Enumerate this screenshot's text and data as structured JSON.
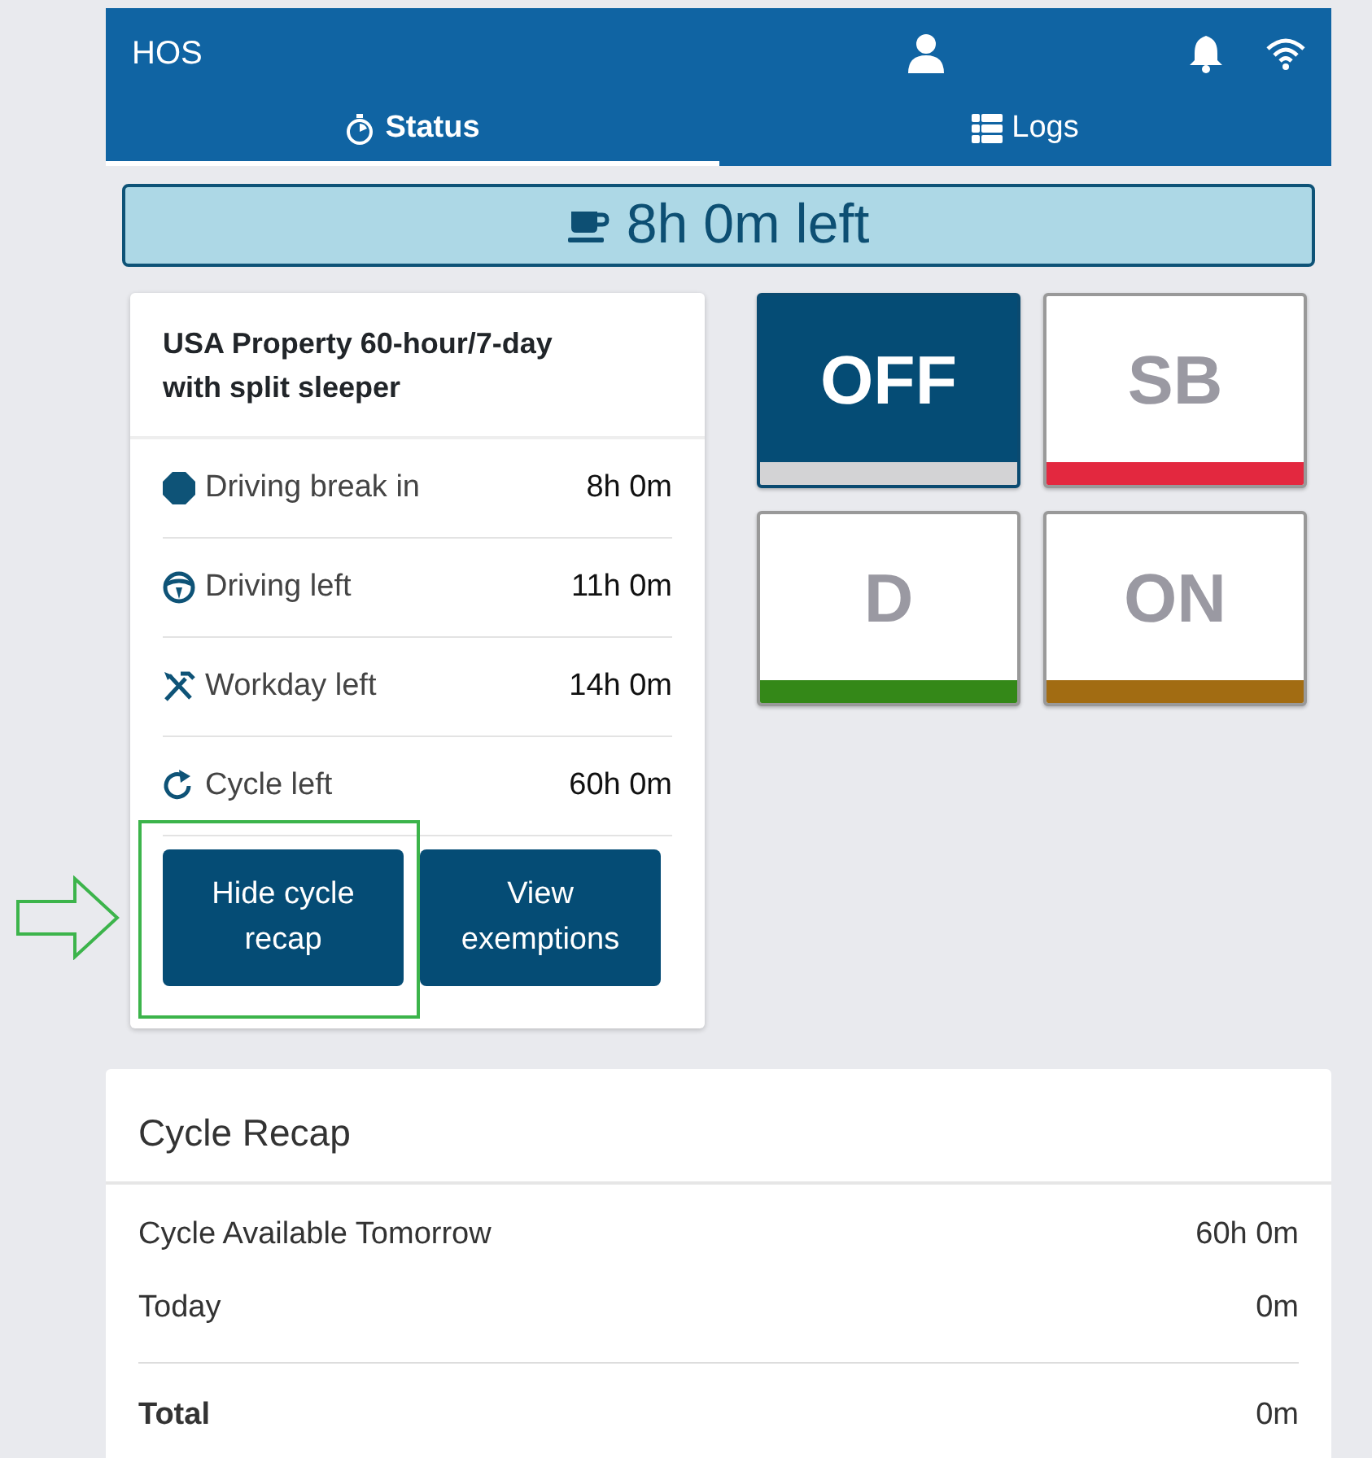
{
  "app_bar": {
    "title": "HOS"
  },
  "tabs": [
    {
      "label": "Status",
      "kind": "status",
      "selected": true
    },
    {
      "label": "Logs",
      "kind": "logs",
      "selected": false
    }
  ],
  "banner": {
    "text": "8h 0m left"
  },
  "ruleset": {
    "title": "USA Property 60-hour/7-day with split sleeper",
    "rows": [
      {
        "kind": "break",
        "label": "Driving break in",
        "value": "8h 0m"
      },
      {
        "kind": "driving",
        "label": "Driving left",
        "value": "11h 0m"
      },
      {
        "kind": "workday",
        "label": "Workday left",
        "value": "14h 0m"
      },
      {
        "kind": "cycle",
        "label": "Cycle left",
        "value": "60h 0m"
      }
    ],
    "buttons": [
      {
        "label": "Hide cycle recap",
        "highlighted": true
      },
      {
        "label": "View exemptions",
        "highlighted": false
      }
    ]
  },
  "duty_status": [
    {
      "label": "OFF",
      "color": "#d3d3d5",
      "selected": true
    },
    {
      "label": "SB",
      "color": "#e3283f",
      "selected": false
    },
    {
      "label": "D",
      "color": "#348818",
      "selected": false
    },
    {
      "label": "ON",
      "color": "#a26c12",
      "selected": false
    }
  ],
  "cycle_recap": {
    "title": "Cycle Recap",
    "rows": [
      {
        "label": "Cycle Available Tomorrow",
        "value": "60h 0m",
        "total": false
      },
      {
        "label": "Today",
        "value": "0m",
        "total": false
      },
      {
        "label": "Total",
        "value": "0m",
        "total": true
      }
    ]
  }
}
